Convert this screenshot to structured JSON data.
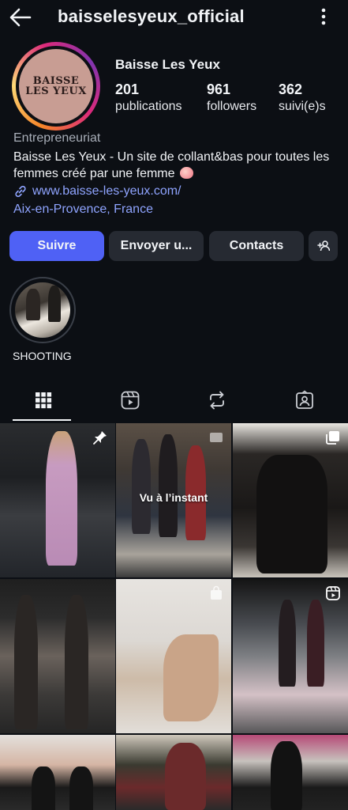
{
  "header": {
    "username": "baisselesyeux_official",
    "back_icon": "arrow-left-icon",
    "more_icon": "more-vertical-icon"
  },
  "profile": {
    "avatar_logo_line1": "BAISSE",
    "avatar_logo_line2": "LES YEUX",
    "display_name": "Baisse Les Yeux",
    "stats": [
      {
        "value": "201",
        "label": "publications"
      },
      {
        "value": "961",
        "label": "followers"
      },
      {
        "value": "362",
        "label": "suivi(e)s"
      }
    ],
    "category": "Entrepreneuriat",
    "bio": "Baisse Les Yeux - Un site de collant&bas pour toutes les femmes créé par une femme",
    "bio_emoji": "peach-emoji-icon",
    "link": "www.baisse-les-yeux.com/",
    "location": "Aix-en-Provence, France"
  },
  "actions": {
    "follow": "Suivre",
    "message": "Envoyer u...",
    "contacts": "Contacts",
    "add_user_icon": "add-user-icon"
  },
  "highlights": [
    {
      "label": "SHOOTING"
    }
  ],
  "tabs": [
    {
      "icon": "grid-icon",
      "active": true
    },
    {
      "icon": "reels-icon",
      "active": false
    },
    {
      "icon": "repost-icon",
      "active": false
    },
    {
      "icon": "tagged-icon",
      "active": false
    }
  ],
  "grid": {
    "posts": [
      {
        "overlay": "pin-icon"
      },
      {
        "overlay": "video-icon",
        "caption": "Vu à l’instant"
      },
      {
        "overlay": "carousel-icon"
      },
      {
        "overlay": ""
      },
      {
        "overlay": "shopping-bag-icon"
      },
      {
        "overlay": "reel-icon"
      },
      {
        "overlay": ""
      },
      {
        "overlay": ""
      },
      {
        "overlay": ""
      }
    ]
  },
  "colors": {
    "background": "#0c0f14",
    "accent_button": "#4f61f5",
    "link": "#8fa4ff",
    "secondary_button": "#262a32"
  }
}
